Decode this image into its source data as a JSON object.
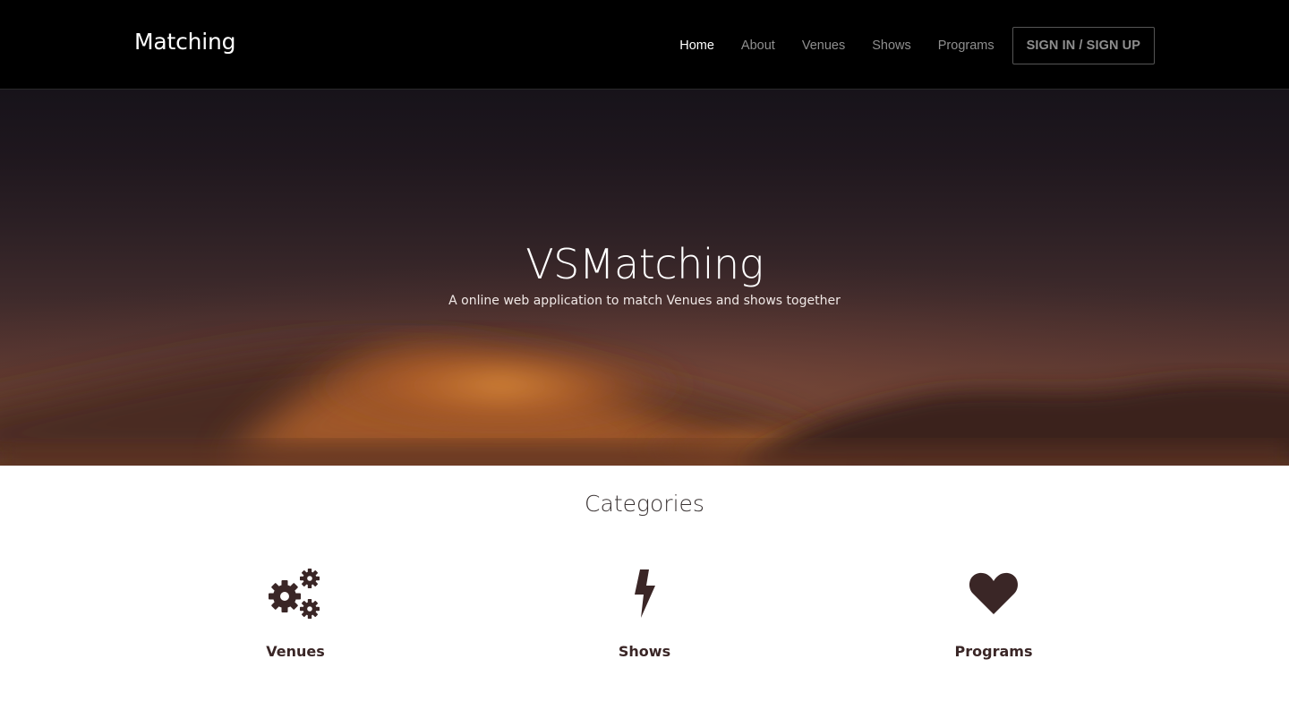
{
  "navbar": {
    "brand": "Matching",
    "links": [
      {
        "label": "Home",
        "active": true
      },
      {
        "label": "About",
        "active": false
      },
      {
        "label": "Venues",
        "active": false
      },
      {
        "label": "Shows",
        "active": false
      },
      {
        "label": "Programs",
        "active": false
      }
    ],
    "signin_label": "SIGN IN / SIGN UP"
  },
  "hero": {
    "title": "VSMatching",
    "subtitle": "A online web application to match Venues and shows together"
  },
  "categories": {
    "heading": "Categories",
    "items": [
      {
        "label": "Venues",
        "icon": "gears-icon"
      },
      {
        "label": "Shows",
        "icon": "bolt-icon"
      },
      {
        "label": "Programs",
        "icon": "heart-icon"
      }
    ]
  },
  "colors": {
    "navbar_bg": "#000000",
    "nav_active": "#ffffff",
    "nav_inactive": "#8f8f8f",
    "icon_color": "#3a2626",
    "hero_glow": "#c06a2a"
  }
}
